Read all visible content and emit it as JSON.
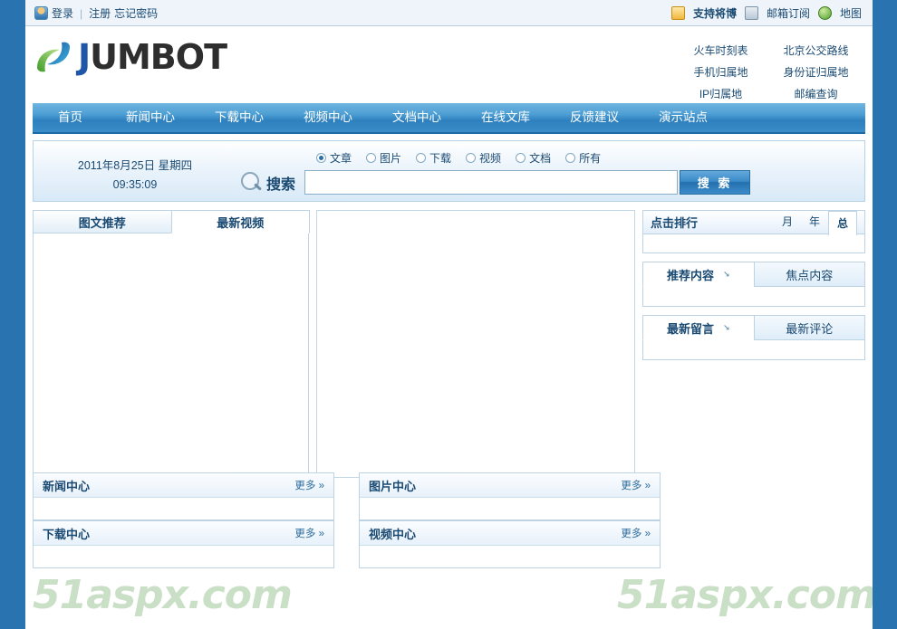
{
  "topbar": {
    "login": "登录",
    "separator": "|",
    "register": "注册",
    "forgot": "忘记密码",
    "support": "支持将博",
    "subscribe": "邮箱订阅",
    "map": "地图",
    "icons": {
      "user": "user-icon",
      "thumb": "thumbs-up-icon",
      "mail": "mail-icon",
      "globe": "globe-icon"
    }
  },
  "logo": {
    "initial": "J",
    "rest": "UMBOT",
    "full": "JUMBOT"
  },
  "quicklinks": [
    "火车时刻表",
    "北京公交路线",
    "手机归属地",
    "身份证归属地",
    "IP归属地",
    "邮编查询"
  ],
  "nav": [
    "首页",
    "新闻中心",
    "下载中心",
    "视频中心",
    "文档中心",
    "在线文库",
    "反馈建议",
    "演示站点"
  ],
  "search": {
    "date": "2011年8月25日 星期四",
    "time": "09:35:09",
    "label": "搜索",
    "placeholder": "",
    "value": "",
    "button": "搜 索",
    "options": [
      {
        "label": "文章",
        "checked": true
      },
      {
        "label": "图片",
        "checked": false
      },
      {
        "label": "下载",
        "checked": false
      },
      {
        "label": "视频",
        "checked": false
      },
      {
        "label": "文档",
        "checked": false
      },
      {
        "label": "所有",
        "checked": false
      }
    ]
  },
  "featured": {
    "tabs": [
      {
        "label": "图文推荐",
        "active": true
      },
      {
        "label": "最新视频",
        "active": false
      }
    ]
  },
  "sidebar": {
    "ranking": {
      "title": "点击排行",
      "tabs": [
        {
          "label": "月",
          "active": false
        },
        {
          "label": "年",
          "active": false
        },
        {
          "label": "总",
          "active": true
        }
      ]
    },
    "recommend": {
      "tabs": [
        {
          "label": "推荐内容",
          "active": true
        },
        {
          "label": "焦点内容",
          "active": false
        }
      ]
    },
    "messages": {
      "tabs": [
        {
          "label": "最新留言",
          "active": true
        },
        {
          "label": "最新评论",
          "active": false
        }
      ]
    }
  },
  "sections": [
    {
      "title": "新闻中心",
      "more": "更多 »"
    },
    {
      "title": "图片中心",
      "more": "更多 »"
    },
    {
      "title": "下载中心",
      "more": "更多 »"
    },
    {
      "title": "视频中心",
      "more": "更多 »"
    }
  ],
  "watermark": "51aspx.com",
  "colors": {
    "side_band": "#2873b0",
    "nav_blue": "#3d8cc8",
    "text_blue": "#1a4a72",
    "watermark_green": "#a9cda4",
    "logo_blue": "#1f56a8"
  }
}
